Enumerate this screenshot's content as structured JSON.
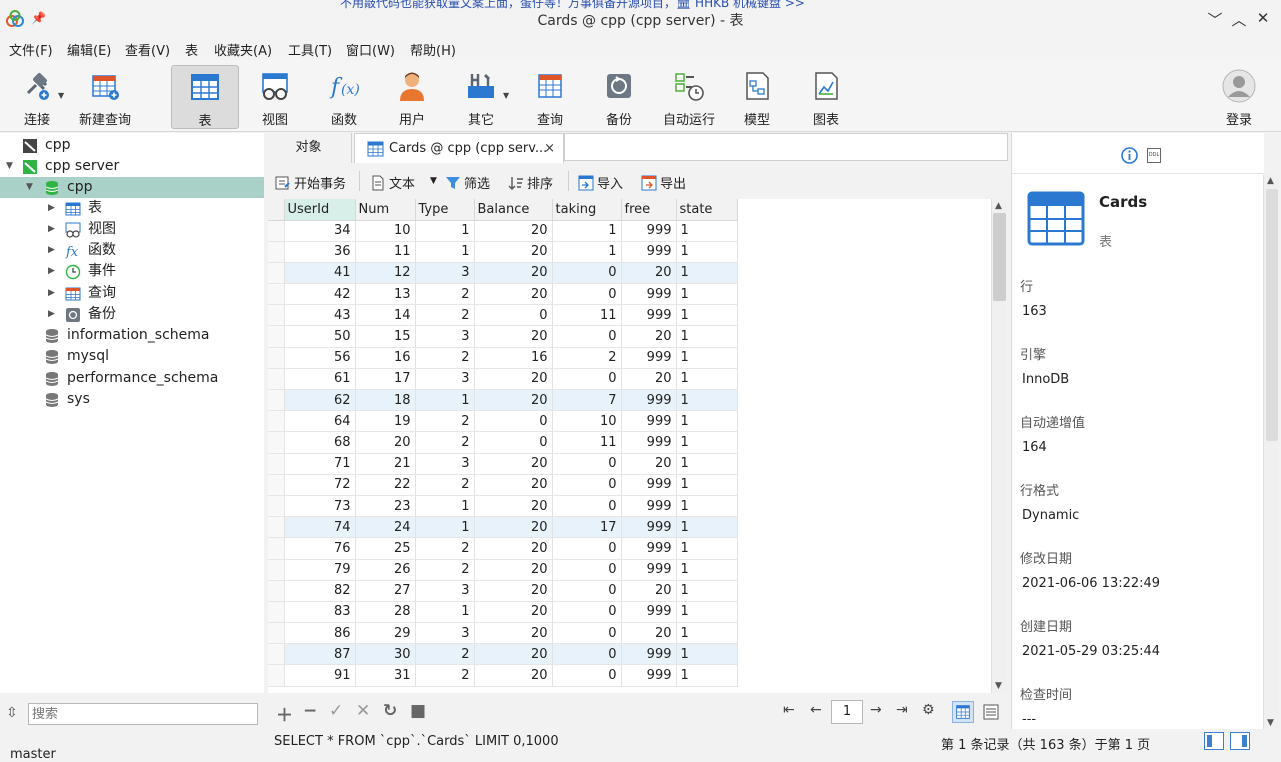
{
  "window": {
    "title": "Cards @ cpp (cpp server) - 表",
    "ghost_banner": "不用敲代码也能获取量文案上面，蛋仔等！万事俱备开源项目，🏛 HHKB 机械键盘 >>"
  },
  "menu": [
    "文件(F)",
    "编辑(E)",
    "查看(V)",
    "表",
    "收藏夹(A)",
    "工具(T)",
    "窗口(W)",
    "帮助(H)"
  ],
  "toolbar": {
    "connect": "连接",
    "new_query": "新建查询",
    "table": "表",
    "view": "视图",
    "function": "函数",
    "user": "用户",
    "other": "其它",
    "query": "查询",
    "backup": "备份",
    "auto_run": "自动运行",
    "model": "模型",
    "chart": "图表",
    "login": "登录"
  },
  "sidebar": {
    "items": [
      {
        "label": "cpp"
      },
      {
        "label": "cpp server"
      },
      {
        "label": "cpp"
      },
      {
        "label": "表"
      },
      {
        "label": "视图"
      },
      {
        "label": "函数"
      },
      {
        "label": "事件"
      },
      {
        "label": "查询"
      },
      {
        "label": "备份"
      },
      {
        "label": "information_schema"
      },
      {
        "label": "mysql"
      },
      {
        "label": "performance_schema"
      },
      {
        "label": "sys"
      }
    ],
    "search_placeholder": "搜索",
    "branch": "master"
  },
  "tabs": {
    "objects": "对象",
    "current": "Cards @ cpp (cpp serv...",
    "close": "×"
  },
  "grid_toolbar": {
    "begin_transaction": "开始事务",
    "text": "文本",
    "filter": "筛选",
    "sort": "排序",
    "import": "导入",
    "export": "导出"
  },
  "grid": {
    "columns": [
      "UserId",
      "Num",
      "Type",
      "Balance",
      "taking",
      "free",
      "state"
    ],
    "rows": [
      [
        "34",
        "10",
        "1",
        "20",
        "1",
        "999",
        "1"
      ],
      [
        "36",
        "11",
        "1",
        "20",
        "1",
        "999",
        "1"
      ],
      [
        "41",
        "12",
        "3",
        "20",
        "0",
        "20",
        "1"
      ],
      [
        "42",
        "13",
        "2",
        "20",
        "0",
        "999",
        "1"
      ],
      [
        "43",
        "14",
        "2",
        "0",
        "11",
        "999",
        "1"
      ],
      [
        "50",
        "15",
        "3",
        "20",
        "0",
        "20",
        "1"
      ],
      [
        "56",
        "16",
        "2",
        "16",
        "2",
        "999",
        "1"
      ],
      [
        "61",
        "17",
        "3",
        "20",
        "0",
        "20",
        "1"
      ],
      [
        "62",
        "18",
        "1",
        "20",
        "7",
        "999",
        "1"
      ],
      [
        "64",
        "19",
        "2",
        "0",
        "10",
        "999",
        "1"
      ],
      [
        "68",
        "20",
        "2",
        "0",
        "11",
        "999",
        "1"
      ],
      [
        "71",
        "21",
        "3",
        "20",
        "0",
        "20",
        "1"
      ],
      [
        "72",
        "22",
        "2",
        "20",
        "0",
        "999",
        "1"
      ],
      [
        "73",
        "23",
        "1",
        "20",
        "0",
        "999",
        "1"
      ],
      [
        "74",
        "24",
        "1",
        "20",
        "17",
        "999",
        "1"
      ],
      [
        "76",
        "25",
        "2",
        "20",
        "0",
        "999",
        "1"
      ],
      [
        "79",
        "26",
        "2",
        "20",
        "0",
        "999",
        "1"
      ],
      [
        "82",
        "27",
        "3",
        "20",
        "0",
        "20",
        "1"
      ],
      [
        "83",
        "28",
        "1",
        "20",
        "0",
        "999",
        "1"
      ],
      [
        "86",
        "29",
        "3",
        "20",
        "0",
        "20",
        "1"
      ],
      [
        "87",
        "30",
        "2",
        "20",
        "0",
        "999",
        "1"
      ],
      [
        "91",
        "31",
        "2",
        "20",
        "0",
        "999",
        "1"
      ]
    ],
    "highlighted_rows": [
      2,
      8,
      14,
      20
    ]
  },
  "pager": {
    "page": "1"
  },
  "status": {
    "sql": "SELECT * FROM `cpp`.`Cards` LIMIT 0,1000",
    "records": "第 1 条记录（共 163 条）于第 1 页"
  },
  "info": {
    "name": "Cards",
    "kind": "表",
    "rows_label": "行",
    "rows_value": "163",
    "engine_label": "引擎",
    "engine_value": "InnoDB",
    "auto_inc_label": "自动递增值",
    "auto_inc_value": "164",
    "row_format_label": "行格式",
    "row_format_value": "Dynamic",
    "modified_label": "修改日期",
    "modified_value": "2021-06-06 13:22:49",
    "created_label": "创建日期",
    "created_value": "2021-05-29 03:25:44",
    "check_label": "检查时间",
    "check_value": "---",
    "ddl": "DDL"
  },
  "colors": {
    "selection": "#a9d1c8",
    "row_highlight": "#e8f2fb",
    "accent": "#2b78d0"
  }
}
